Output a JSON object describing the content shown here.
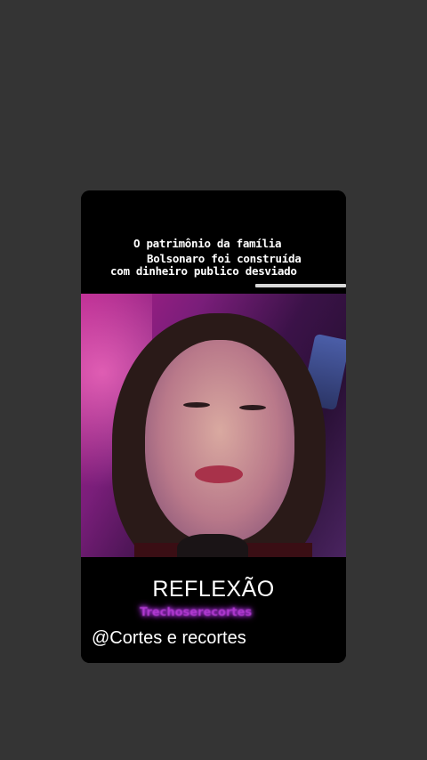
{
  "story": {
    "caption_lines": [
      "O patrimônio da família",
      "Bolsonaro foi construída",
      "com dinheiro publico desviado"
    ],
    "title": "REFLEXÃO",
    "watermark": "Trechoserecortes",
    "handle": "@Cortes e recortes"
  },
  "colors": {
    "background": "#343434",
    "card": "#000000",
    "watermark_glow": "#c238ff"
  }
}
